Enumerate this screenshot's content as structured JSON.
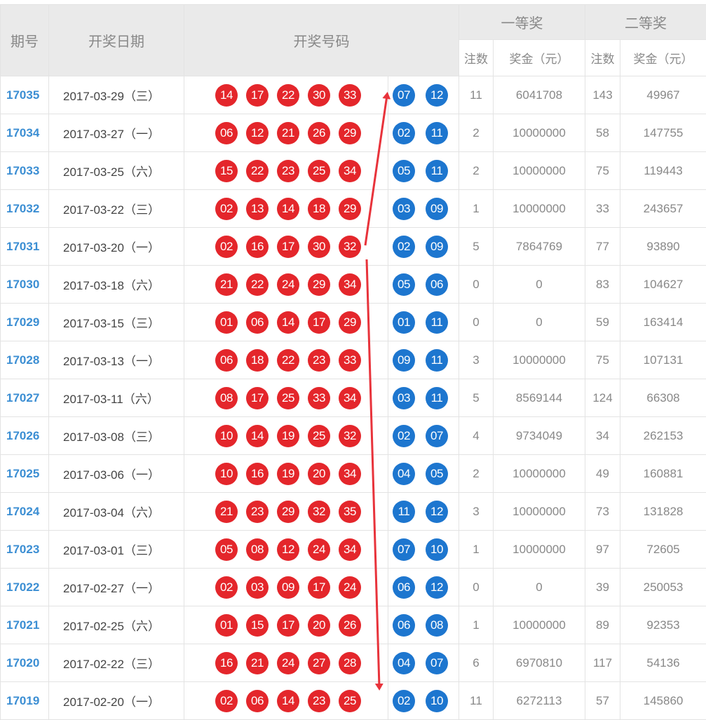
{
  "headers": {
    "issue": "期号",
    "date": "开奖日期",
    "numbers": "开奖号码",
    "first_prize": "一等奖",
    "second_prize": "二等奖",
    "count": "注数",
    "amount": "奖金（元）"
  },
  "colors": {
    "red_ball": "#e4262b",
    "blue_ball": "#1d76cf",
    "issue_text": "#3b8ed3",
    "arrow": "#e8333b"
  },
  "rows": [
    {
      "issue": "17035",
      "date": "2017-03-29（三）",
      "reds": [
        "14",
        "17",
        "22",
        "30",
        "33"
      ],
      "blues": [
        "07",
        "12"
      ],
      "first_count": "11",
      "first_amount": "6041708",
      "second_count": "143",
      "second_amount": "49967"
    },
    {
      "issue": "17034",
      "date": "2017-03-27（一）",
      "reds": [
        "06",
        "12",
        "21",
        "26",
        "29"
      ],
      "blues": [
        "02",
        "11"
      ],
      "first_count": "2",
      "first_amount": "10000000",
      "second_count": "58",
      "second_amount": "147755"
    },
    {
      "issue": "17033",
      "date": "2017-03-25（六）",
      "reds": [
        "15",
        "22",
        "23",
        "25",
        "34"
      ],
      "blues": [
        "05",
        "11"
      ],
      "first_count": "2",
      "first_amount": "10000000",
      "second_count": "75",
      "second_amount": "119443"
    },
    {
      "issue": "17032",
      "date": "2017-03-22（三）",
      "reds": [
        "02",
        "13",
        "14",
        "18",
        "29"
      ],
      "blues": [
        "03",
        "09"
      ],
      "first_count": "1",
      "first_amount": "10000000",
      "second_count": "33",
      "second_amount": "243657"
    },
    {
      "issue": "17031",
      "date": "2017-03-20（一）",
      "reds": [
        "02",
        "16",
        "17",
        "30",
        "32"
      ],
      "blues": [
        "02",
        "09"
      ],
      "first_count": "5",
      "first_amount": "7864769",
      "second_count": "77",
      "second_amount": "93890"
    },
    {
      "issue": "17030",
      "date": "2017-03-18（六）",
      "reds": [
        "21",
        "22",
        "24",
        "29",
        "34"
      ],
      "blues": [
        "05",
        "06"
      ],
      "first_count": "0",
      "first_amount": "0",
      "second_count": "83",
      "second_amount": "104627"
    },
    {
      "issue": "17029",
      "date": "2017-03-15（三）",
      "reds": [
        "01",
        "06",
        "14",
        "17",
        "29"
      ],
      "blues": [
        "01",
        "11"
      ],
      "first_count": "0",
      "first_amount": "0",
      "second_count": "59",
      "second_amount": "163414"
    },
    {
      "issue": "17028",
      "date": "2017-03-13（一）",
      "reds": [
        "06",
        "18",
        "22",
        "23",
        "33"
      ],
      "blues": [
        "09",
        "11"
      ],
      "first_count": "3",
      "first_amount": "10000000",
      "second_count": "75",
      "second_amount": "107131"
    },
    {
      "issue": "17027",
      "date": "2017-03-11（六）",
      "reds": [
        "08",
        "17",
        "25",
        "33",
        "34"
      ],
      "blues": [
        "03",
        "11"
      ],
      "first_count": "5",
      "first_amount": "8569144",
      "second_count": "124",
      "second_amount": "66308"
    },
    {
      "issue": "17026",
      "date": "2017-03-08（三）",
      "reds": [
        "10",
        "14",
        "19",
        "25",
        "32"
      ],
      "blues": [
        "02",
        "07"
      ],
      "first_count": "4",
      "first_amount": "9734049",
      "second_count": "34",
      "second_amount": "262153"
    },
    {
      "issue": "17025",
      "date": "2017-03-06（一）",
      "reds": [
        "10",
        "16",
        "19",
        "20",
        "34"
      ],
      "blues": [
        "04",
        "05"
      ],
      "first_count": "2",
      "first_amount": "10000000",
      "second_count": "49",
      "second_amount": "160881"
    },
    {
      "issue": "17024",
      "date": "2017-03-04（六）",
      "reds": [
        "21",
        "23",
        "29",
        "32",
        "35"
      ],
      "blues": [
        "11",
        "12"
      ],
      "first_count": "3",
      "first_amount": "10000000",
      "second_count": "73",
      "second_amount": "131828"
    },
    {
      "issue": "17023",
      "date": "2017-03-01（三）",
      "reds": [
        "05",
        "08",
        "12",
        "24",
        "34"
      ],
      "blues": [
        "07",
        "10"
      ],
      "first_count": "1",
      "first_amount": "10000000",
      "second_count": "97",
      "second_amount": "72605"
    },
    {
      "issue": "17022",
      "date": "2017-02-27（一）",
      "reds": [
        "02",
        "03",
        "09",
        "17",
        "24"
      ],
      "blues": [
        "06",
        "12"
      ],
      "first_count": "0",
      "first_amount": "0",
      "second_count": "39",
      "second_amount": "250053"
    },
    {
      "issue": "17021",
      "date": "2017-02-25（六）",
      "reds": [
        "01",
        "15",
        "17",
        "20",
        "26"
      ],
      "blues": [
        "06",
        "08"
      ],
      "first_count": "1",
      "first_amount": "10000000",
      "second_count": "89",
      "second_amount": "92353"
    },
    {
      "issue": "17020",
      "date": "2017-02-22（三）",
      "reds": [
        "16",
        "21",
        "24",
        "27",
        "28"
      ],
      "blues": [
        "04",
        "07"
      ],
      "first_count": "6",
      "first_amount": "6970810",
      "second_count": "117",
      "second_amount": "54136"
    },
    {
      "issue": "17019",
      "date": "2017-02-20（一）",
      "reds": [
        "02",
        "06",
        "14",
        "23",
        "25"
      ],
      "blues": [
        "02",
        "10"
      ],
      "first_count": "11",
      "first_amount": "6272113",
      "second_count": "57",
      "second_amount": "145860"
    }
  ]
}
